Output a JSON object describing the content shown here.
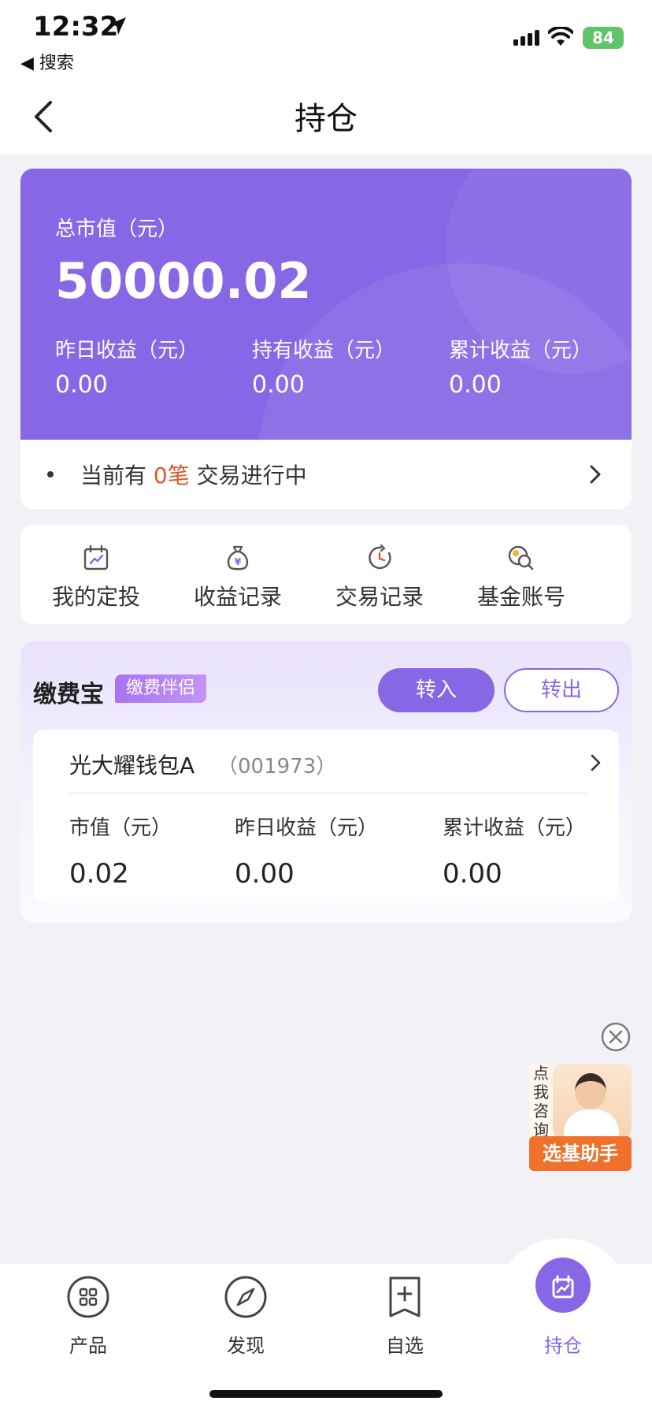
{
  "status_bar": {
    "time": "12:32",
    "back_app": "◀ 搜索",
    "battery": "84"
  },
  "header": {
    "title": "持仓"
  },
  "summary": {
    "total_label": "总市值（元）",
    "total_value": "50000.02",
    "stats": [
      {
        "label": "昨日收益（元）",
        "value": "0.00"
      },
      {
        "label": "持有收益（元）",
        "value": "0.00"
      },
      {
        "label": "累计收益（元）",
        "value": "0.00"
      }
    ],
    "pending": {
      "prefix": "当前有",
      "count": "0笔",
      "suffix": "交易进行中"
    }
  },
  "quick_actions": [
    {
      "label": "我的定投",
      "icon": "calendar-chart-icon"
    },
    {
      "label": "收益记录",
      "icon": "money-bag-icon"
    },
    {
      "label": "交易记录",
      "icon": "clock-icon"
    },
    {
      "label": "基金账号",
      "icon": "coin-search-icon"
    }
  ],
  "jiaofeibao": {
    "title": "缴费宝",
    "tag": "缴费伴侣",
    "transfer_in": "转入",
    "transfer_out": "转出",
    "fund": {
      "name": "光大耀钱包A",
      "code": "（001973）",
      "stats": [
        {
          "label": "市值（元）",
          "value": "0.02"
        },
        {
          "label": "昨日收益（元）",
          "value": "0.00"
        },
        {
          "label": "累计收益（元）",
          "value": "0.00"
        }
      ]
    }
  },
  "assistant": {
    "ask": "点我咨询",
    "label": "选基助手"
  },
  "tabbar": [
    {
      "label": "产品",
      "icon": "grid-icon"
    },
    {
      "label": "发现",
      "icon": "compass-icon"
    },
    {
      "label": "自选",
      "icon": "add-bookmark-icon"
    },
    {
      "label": "持仓",
      "icon": "holdings-icon",
      "active": true
    }
  ],
  "colors": {
    "accent": "#8767e6",
    "highlight": "#e0562d",
    "assistant": "#f0712b"
  }
}
